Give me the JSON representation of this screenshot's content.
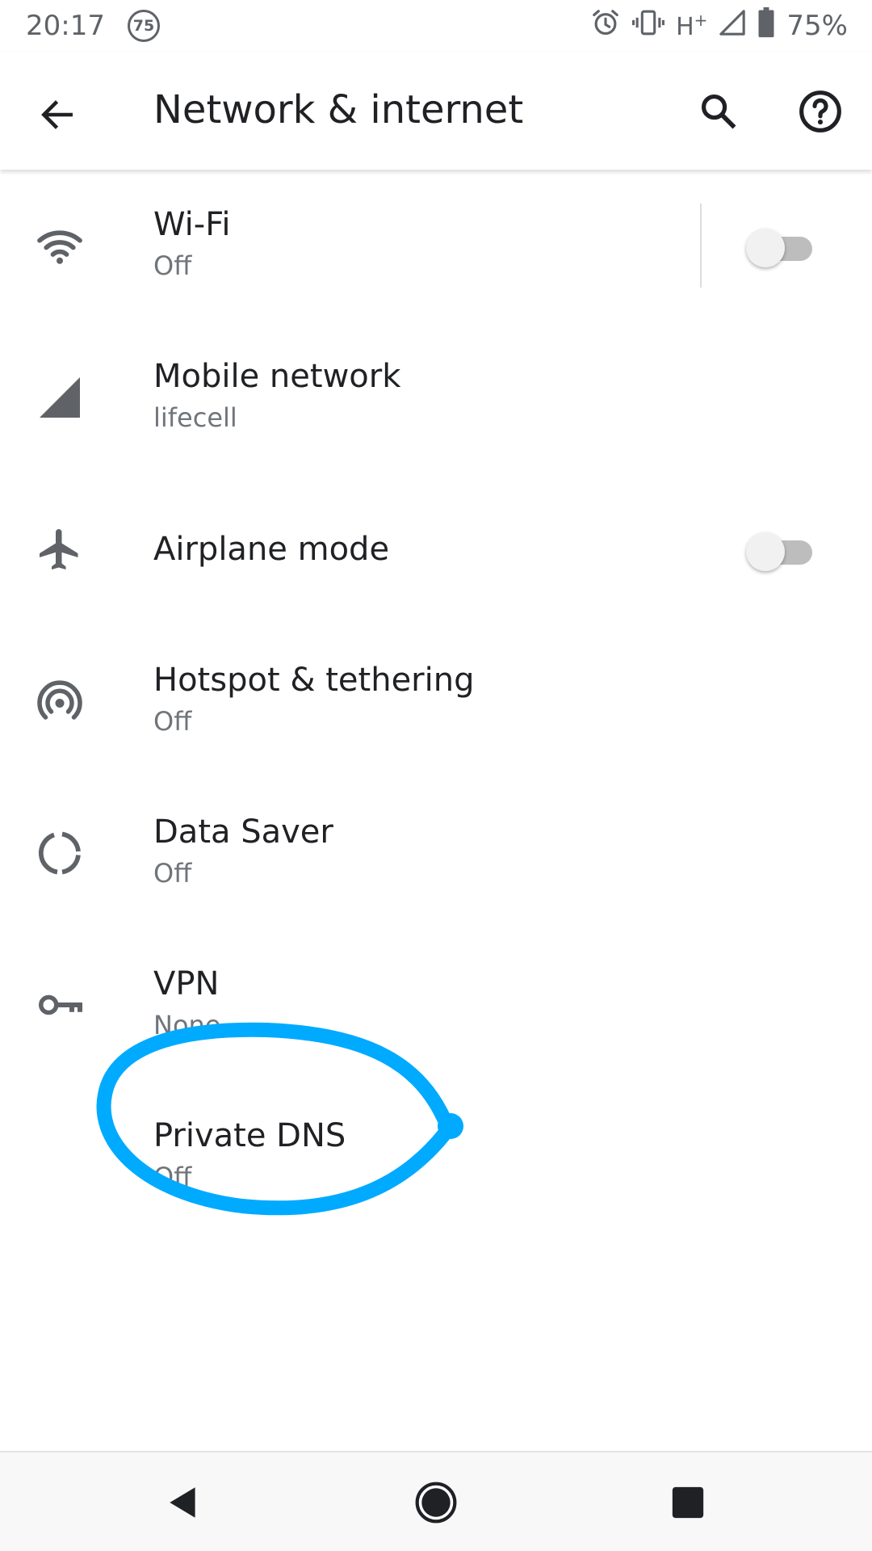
{
  "status_bar": {
    "time": "20:17",
    "notification_count": "75",
    "network_type": "H",
    "network_type_suffix": "+",
    "battery_percent": "75%",
    "icons": [
      "alarm-icon",
      "vibrate-icon",
      "signal-icon",
      "battery-icon"
    ]
  },
  "app_bar": {
    "title": "Network & internet",
    "icons": [
      "back-arrow-icon",
      "search-icon",
      "help-icon"
    ]
  },
  "settings": [
    {
      "title": "Wi-Fi",
      "summary": "Off",
      "icon": "wifi-icon",
      "toggle": false
    },
    {
      "title": "Mobile network",
      "summary": "lifecell",
      "icon": "signal-icon"
    },
    {
      "title": "Airplane mode",
      "icon": "airplane-icon",
      "toggle": false
    },
    {
      "title": "Hotspot & tethering",
      "summary": "Off",
      "icon": "hotspot-icon"
    },
    {
      "title": "Data Saver",
      "summary": "Off",
      "icon": "data-saver-icon"
    },
    {
      "title": "VPN",
      "summary": "None",
      "icon": "vpn-key-icon"
    },
    {
      "title": "Private DNS",
      "summary": "Off"
    }
  ],
  "annotation": {
    "color": "#00aaff",
    "target": "Private DNS"
  },
  "nav_bar": {
    "icons": [
      "back-triangle-icon",
      "home-circle-icon",
      "recents-square-icon"
    ]
  },
  "colors": {
    "primary_text": "#202124",
    "secondary_text": "#70757a",
    "icon": "#5f6368",
    "switch_track_off": "#bdbdbd",
    "switch_thumb_off": "#f1f1f1"
  }
}
